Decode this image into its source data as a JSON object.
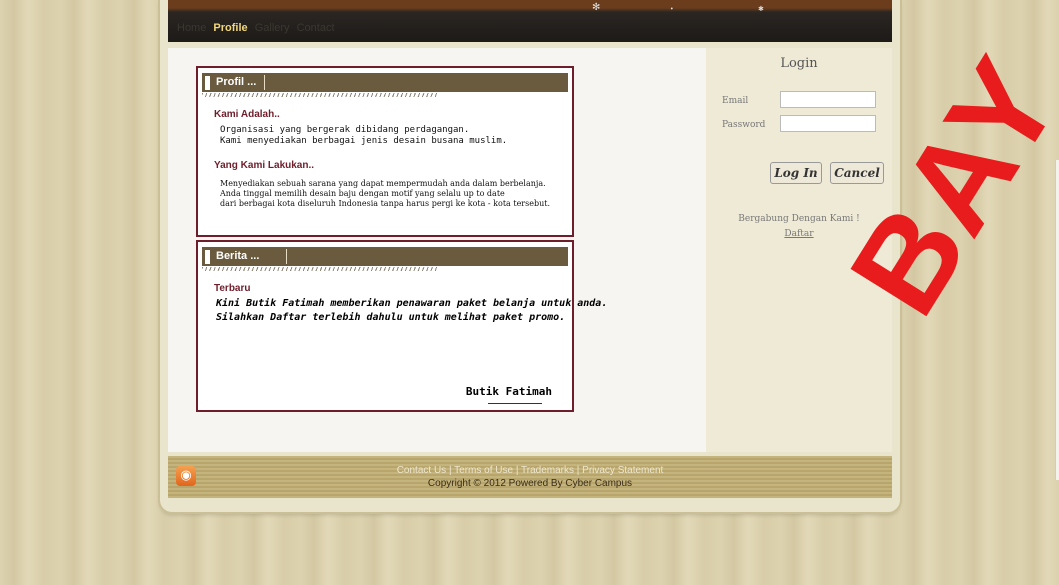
{
  "nav": {
    "items": [
      "Home",
      "Profile",
      "Gallery",
      "Contact"
    ],
    "active": "Profile"
  },
  "profil": {
    "title": "Profil ...",
    "kami_heading": "Kami Adalah..",
    "kami_lines": [
      "Organisasi yang bergerak dibidang perdagangan.",
      "Kami menyediakan berbagai jenis desain busana muslim."
    ],
    "lakukan_heading": "Yang Kami Lakukan..",
    "lakukan_lines": [
      "Menyediakan sebuah sarana yang dapat mempermudah anda dalam berbelanja.",
      "Anda tinggal memilih desain baju dengan motif yang selalu up to date",
      "dari berbagai kota diseluruh Indonesia tanpa harus pergi ke kota - kota tersebut."
    ]
  },
  "berita": {
    "title": "Berita ...",
    "heading": "Terbaru",
    "lines": [
      "Kini Butik Fatimah memberikan penawaran paket belanja untuk anda.",
      "Silahkan Daftar terlebih dahulu untuk melihat paket promo."
    ],
    "signature": "Butik Fatimah"
  },
  "login": {
    "title": "Login",
    "email_label": "Email",
    "password_label": "Password",
    "login_button": "Log In",
    "cancel_button": "Cancel",
    "join_text": "Bergabung Dengan Kami !",
    "register_link": "Daftar"
  },
  "footer": {
    "links": "Contact Us | Terms of Use | Trademarks | Privacy Statement",
    "copyright": "Copyright © 2012 Powered By Cyber Campus"
  },
  "watermark": "BAY",
  "colors": {
    "accent": "#6e1e2a",
    "header": "#6a5a3e",
    "watermark": "#e81c1c"
  }
}
